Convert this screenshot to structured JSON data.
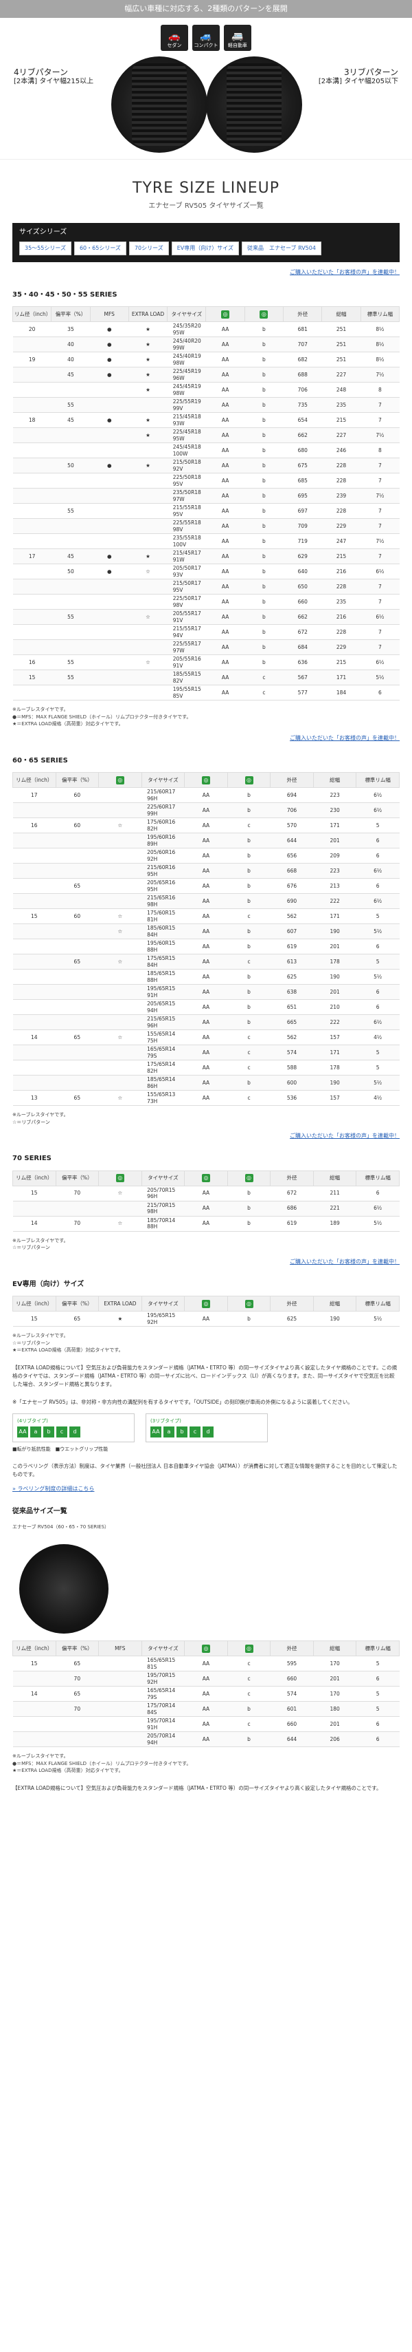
{
  "hero": {
    "banner": "幅広い車種に対応する、2種類のパターンを展開",
    "icons": [
      {
        "name": "sedan-icon",
        "label": "セダン",
        "glyph": "🚗"
      },
      {
        "name": "compact-icon",
        "label": "コンパクト",
        "glyph": "🚙"
      },
      {
        "name": "minivan-icon",
        "label": "軽自動車",
        "glyph": "🚐"
      }
    ],
    "left_title": "4リブパターン",
    "left_sub": "[2本溝] タイヤ幅215以上",
    "right_title": "3リブパターン",
    "right_sub": "[2本溝] タイヤ幅205以下"
  },
  "lineup": {
    "title": "TYRE SIZE LINEUP",
    "subtitle": "エナセーブ RV505 タイヤサイズ一覧",
    "series_label": "サイズシリーズ",
    "buttons": [
      "35～55シリーズ",
      "60・65シリーズ",
      "70シリーズ",
      "EV専用（向け）サイズ",
      "従来品　エナセーブ RV504"
    ]
  },
  "link_text": "ご購入いただいた「お客様の声」を連載中！",
  "s1": {
    "title": "35・40・45・50・55 SERIES",
    "headers": [
      "リム径（inch）",
      "偏平率（%）",
      "MFS",
      "EXTRA LOAD",
      "タイヤサイズ",
      "",
      "",
      "外径",
      "総幅",
      "標準リム幅"
    ],
    "rows": [
      [
        "20",
        "35",
        "●",
        "★",
        "245/35R20 95W",
        "AA",
        "b",
        "681",
        "251",
        "8½"
      ],
      [
        "",
        "40",
        "●",
        "★",
        "245/40R20 99W",
        "AA",
        "b",
        "707",
        "251",
        "8½"
      ],
      [
        "19",
        "40",
        "●",
        "★",
        "245/40R19 98W",
        "AA",
        "b",
        "682",
        "251",
        "8½"
      ],
      [
        "",
        "45",
        "●",
        "★",
        "225/45R19 96W",
        "AA",
        "b",
        "688",
        "227",
        "7½"
      ],
      [
        "",
        "",
        "",
        "★",
        "245/45R19 98W",
        "AA",
        "b",
        "706",
        "248",
        "8"
      ],
      [
        "",
        "55",
        "",
        "",
        "225/55R19 99V",
        "AA",
        "b",
        "735",
        "235",
        "7"
      ],
      [
        "18",
        "45",
        "●",
        "★",
        "215/45R18 93W",
        "AA",
        "b",
        "654",
        "215",
        "7"
      ],
      [
        "",
        "",
        "",
        "★",
        "225/45R18 95W",
        "AA",
        "b",
        "662",
        "227",
        "7½"
      ],
      [
        "",
        "",
        "",
        "",
        "245/45R18 100W",
        "AA",
        "b",
        "680",
        "246",
        "8"
      ],
      [
        "",
        "50",
        "●",
        "★",
        "215/50R18 92V",
        "AA",
        "b",
        "675",
        "228",
        "7"
      ],
      [
        "",
        "",
        "",
        "",
        "225/50R18 95V",
        "AA",
        "b",
        "685",
        "228",
        "7"
      ],
      [
        "",
        "",
        "",
        "",
        "235/50R18 97W",
        "AA",
        "b",
        "695",
        "239",
        "7½"
      ],
      [
        "",
        "55",
        "",
        "",
        "215/55R18 95V",
        "AA",
        "b",
        "697",
        "228",
        "7"
      ],
      [
        "",
        "",
        "",
        "",
        "225/55R18 98V",
        "AA",
        "b",
        "709",
        "229",
        "7"
      ],
      [
        "",
        "",
        "",
        "",
        "235/55R18 100V",
        "AA",
        "b",
        "719",
        "247",
        "7½"
      ],
      [
        "17",
        "45",
        "●",
        "★",
        "215/45R17 91W",
        "AA",
        "b",
        "629",
        "215",
        "7"
      ],
      [
        "",
        "50",
        "●",
        "☆",
        "205/50R17 93V",
        "AA",
        "b",
        "640",
        "216",
        "6½"
      ],
      [
        "",
        "",
        "",
        "",
        "215/50R17 95V",
        "AA",
        "b",
        "650",
        "228",
        "7"
      ],
      [
        "",
        "",
        "",
        "",
        "225/50R17 98V",
        "AA",
        "b",
        "660",
        "235",
        "7"
      ],
      [
        "",
        "55",
        "",
        "☆",
        "205/55R17 91V",
        "AA",
        "b",
        "662",
        "216",
        "6½"
      ],
      [
        "",
        "",
        "",
        "",
        "215/55R17 94V",
        "AA",
        "b",
        "672",
        "228",
        "7"
      ],
      [
        "",
        "",
        "",
        "",
        "225/55R17 97W",
        "AA",
        "b",
        "684",
        "229",
        "7"
      ],
      [
        "16",
        "55",
        "",
        "☆",
        "205/55R16 91V",
        "AA",
        "b",
        "636",
        "215",
        "6½"
      ],
      [
        "15",
        "55",
        "",
        "",
        "185/55R15 82V",
        "AA",
        "c",
        "567",
        "171",
        "5½"
      ],
      [
        "",
        "",
        "",
        "",
        "195/55R15 85V",
        "AA",
        "c",
        "577",
        "184",
        "6"
      ]
    ],
    "notes": "※ルーブレスタイヤです。\n●＝MFS：MAX FLANGE SHIELD（ホイール）リムプロテクター付きタイヤです。\n★＝EXTRA LOAD規格（高荷重）対応タイヤです。"
  },
  "s2": {
    "title": "60・65 SERIES",
    "headers": [
      "リム径（inch）",
      "偏平率（%）",
      "",
      "タイヤサイズ",
      "",
      "",
      "外径",
      "総幅",
      "標準リム幅"
    ],
    "rows": [
      [
        "17",
        "60",
        "",
        "215/60R17 96H",
        "AA",
        "b",
        "694",
        "223",
        "6½"
      ],
      [
        "",
        "",
        "",
        "225/60R17 99H",
        "AA",
        "b",
        "706",
        "230",
        "6½"
      ],
      [
        "16",
        "60",
        "☆",
        "175/60R16 82H",
        "AA",
        "c",
        "570",
        "171",
        "5"
      ],
      [
        "",
        "",
        "",
        "195/60R16 89H",
        "AA",
        "b",
        "644",
        "201",
        "6"
      ],
      [
        "",
        "",
        "",
        "205/60R16 92H",
        "AA",
        "b",
        "656",
        "209",
        "6"
      ],
      [
        "",
        "",
        "",
        "215/60R16 95H",
        "AA",
        "b",
        "668",
        "223",
        "6½"
      ],
      [
        "",
        "65",
        "",
        "205/65R16 95H",
        "AA",
        "b",
        "676",
        "213",
        "6"
      ],
      [
        "",
        "",
        "",
        "215/65R16 98H",
        "AA",
        "b",
        "690",
        "222",
        "6½"
      ],
      [
        "15",
        "60",
        "☆",
        "175/60R15 81H",
        "AA",
        "c",
        "562",
        "171",
        "5"
      ],
      [
        "",
        "",
        "☆",
        "185/60R15 84H",
        "AA",
        "b",
        "607",
        "190",
        "5½"
      ],
      [
        "",
        "",
        "",
        "195/60R15 88H",
        "AA",
        "b",
        "619",
        "201",
        "6"
      ],
      [
        "",
        "65",
        "☆",
        "175/65R15 84H",
        "AA",
        "c",
        "613",
        "178",
        "5"
      ],
      [
        "",
        "",
        "",
        "185/65R15 88H",
        "AA",
        "b",
        "625",
        "190",
        "5½"
      ],
      [
        "",
        "",
        "",
        "195/65R15 91H",
        "AA",
        "b",
        "638",
        "201",
        "6"
      ],
      [
        "",
        "",
        "",
        "205/65R15 94H",
        "AA",
        "b",
        "651",
        "210",
        "6"
      ],
      [
        "",
        "",
        "",
        "215/65R15 96H",
        "AA",
        "b",
        "665",
        "222",
        "6½"
      ],
      [
        "14",
        "65",
        "☆",
        "155/65R14 75H",
        "AA",
        "c",
        "562",
        "157",
        "4½"
      ],
      [
        "",
        "",
        "",
        "165/65R14 79S",
        "AA",
        "c",
        "574",
        "171",
        "5"
      ],
      [
        "",
        "",
        "",
        "175/65R14 82H",
        "AA",
        "c",
        "588",
        "178",
        "5"
      ],
      [
        "",
        "",
        "",
        "185/65R14 86H",
        "AA",
        "b",
        "600",
        "190",
        "5½"
      ],
      [
        "13",
        "65",
        "☆",
        "155/65R13 73H",
        "AA",
        "c",
        "536",
        "157",
        "4½"
      ]
    ],
    "notes": "※ルーブレスタイヤです。\n☆＝リブパターン"
  },
  "s3": {
    "title": "70 SERIES",
    "headers": [
      "リム径（inch）",
      "偏平率（%）",
      "",
      "タイヤサイズ",
      "",
      "",
      "外径",
      "総幅",
      "標準リム幅"
    ],
    "rows": [
      [
        "15",
        "70",
        "☆",
        "205/70R15 96H",
        "AA",
        "b",
        "672",
        "211",
        "6"
      ],
      [
        "",
        "",
        "",
        "215/70R15 98H",
        "AA",
        "b",
        "686",
        "221",
        "6½"
      ],
      [
        "14",
        "70",
        "☆",
        "185/70R14 88H",
        "AA",
        "b",
        "619",
        "189",
        "5½"
      ]
    ],
    "notes": "※ルーブレスタイヤです。\n☆＝リブパターン"
  },
  "s4": {
    "title": "EV専用（向け）サイズ",
    "headers": [
      "リム径（inch）",
      "偏平率（%）",
      "EXTRA LOAD",
      "タイヤサイズ",
      "",
      "",
      "外径",
      "総幅",
      "標準リム幅"
    ],
    "rows": [
      [
        "15",
        "65",
        "★",
        "195/65R15 92H",
        "AA",
        "b",
        "625",
        "190",
        "5½"
      ]
    ],
    "notes": "※ルーブレスタイヤです。\n☆＝リブパターン\n★＝EXTRA LOAD規格（高荷重）対応タイヤです。"
  },
  "para1": "【EXTRA LOAD規格について】空気圧および負荷能力をスタンダード規格（JATMA・ETRTO 等）の同一サイズタイヤより高く設定したタイヤ規格のことです。この規格のタイヤでは、スタンダード規格（JATMA・ETRTO 等）の同一サイズに比べ、ロードインデックス（LI）が高くなります。また、同一サイズタイヤで空気圧を比較した場合、スタンダード規格と異なります。",
  "para2": "※「エナセーブ RV505」は、非対称・非方向性の溝配列を有するタイヤです。「OUTSIDE」の刻印側が車両の外側になるように装着してください。",
  "labels": {
    "left_title": "(4リブタイプ)",
    "right_title": "(3リブタイプ)",
    "grades_left": [
      "AA",
      "a",
      "b",
      "c",
      "d"
    ],
    "grades_right": [
      "AA",
      "a",
      "b",
      "c",
      "d"
    ],
    "legend": "■転がり抵抗性能　■ウエットグリップ性能"
  },
  "para3": "このラベリング（表示方法）制度は、タイヤ業界（一般社団法人 日本自動車タイヤ協会（JATMA））が消費者に対して適正な情報を提供することを目的として策定したものです。",
  "link2": "» ラベリング制度の詳細はこちら",
  "old": {
    "title": "従来品サイズ一覧",
    "subtitle": "エナセーブ RV504（60・65・70 SERIES）",
    "headers": [
      "リム径（inch）",
      "偏平率（%）",
      "MFS",
      "タイヤサイズ",
      "",
      "",
      "外径",
      "総幅",
      "標準リム幅"
    ],
    "rows": [
      [
        "15",
        "65",
        "",
        "165/65R15 81S",
        "AA",
        "c",
        "595",
        "170",
        "5"
      ],
      [
        "",
        "70",
        "",
        "195/70R15 92H",
        "AA",
        "c",
        "660",
        "201",
        "6"
      ],
      [
        "14",
        "65",
        "",
        "165/65R14 79S",
        "AA",
        "c",
        "574",
        "170",
        "5"
      ],
      [
        "",
        "70",
        "",
        "175/70R14 84S",
        "AA",
        "b",
        "601",
        "180",
        "5"
      ],
      [
        "",
        "",
        "",
        "195/70R14 91H",
        "AA",
        "c",
        "660",
        "201",
        "6"
      ],
      [
        "",
        "",
        "",
        "205/70R14 94H",
        "AA",
        "b",
        "644",
        "206",
        "6"
      ]
    ],
    "notes": "※ルーブレスタイヤです。\n●＝MFS：MAX FLANGE SHIELD（ホイール）リムプロテクター付きタイヤです。\n★＝EXTRA LOAD規格（高荷重）対応タイヤです。"
  },
  "foot": "【EXTRA LOAD規格について】空気圧および負荷能力をスタンダード規格（JATMA・ETRTO 等）の同一サイズタイヤより高く設定したタイヤ規格のことです。"
}
